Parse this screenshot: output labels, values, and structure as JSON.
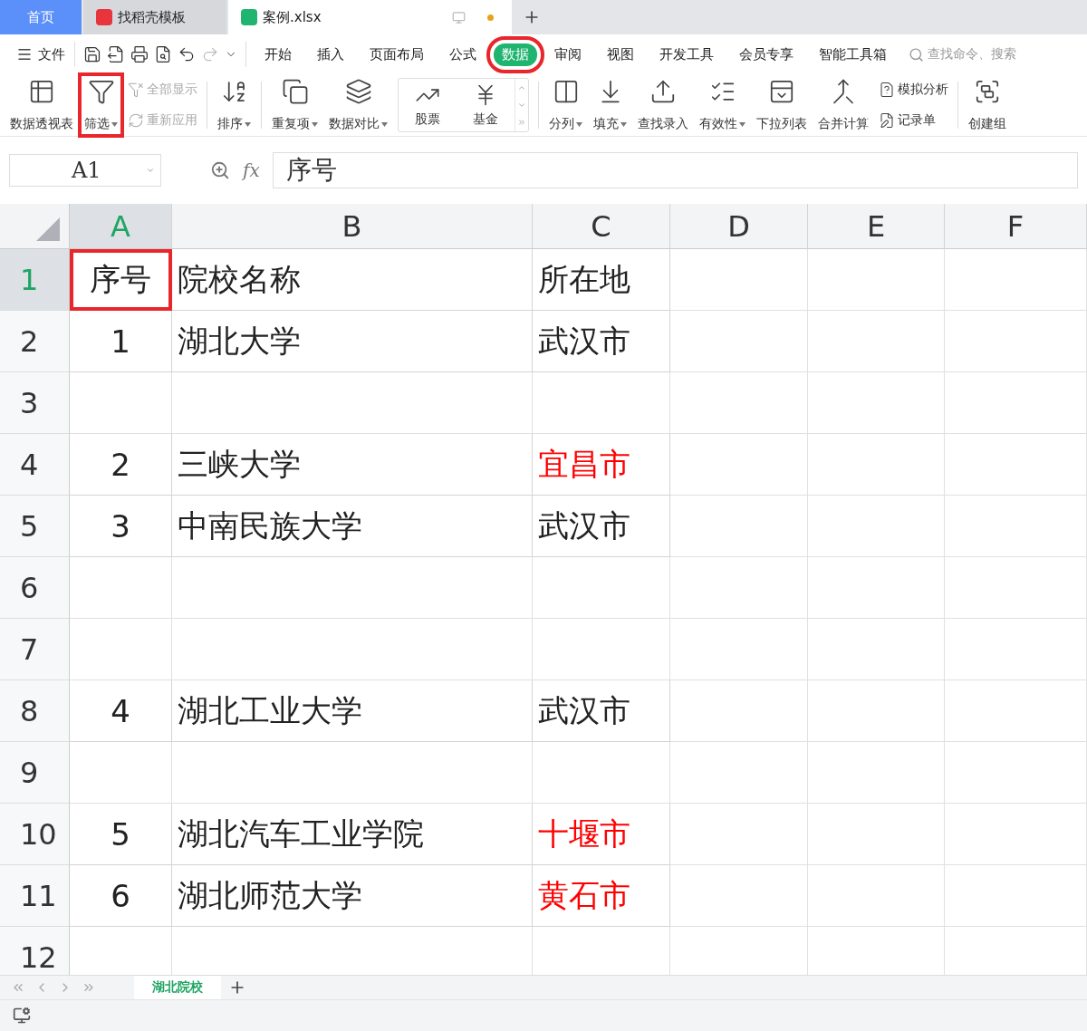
{
  "title_tabs": [
    {
      "label": "首页",
      "kind": "home",
      "selected": false
    },
    {
      "label": "找稻壳模板",
      "kind": "docer",
      "selected": false
    },
    {
      "label": "案例.xlsx",
      "kind": "sheet",
      "selected": true
    }
  ],
  "menu": {
    "file": "文件",
    "items": [
      {
        "label": "开始",
        "selected": false,
        "highlighted": false
      },
      {
        "label": "插入",
        "selected": false,
        "highlighted": false
      },
      {
        "label": "页面布局",
        "selected": false,
        "highlighted": false
      },
      {
        "label": "公式",
        "selected": false,
        "highlighted": false
      },
      {
        "label": "数据",
        "selected": true,
        "highlighted": true
      },
      {
        "label": "审阅",
        "selected": false,
        "highlighted": false
      },
      {
        "label": "视图",
        "selected": false,
        "highlighted": false
      },
      {
        "label": "开发工具",
        "selected": false,
        "highlighted": false
      },
      {
        "label": "会员专享",
        "selected": false,
        "highlighted": false
      },
      {
        "label": "智能工具箱",
        "selected": false,
        "highlighted": false
      }
    ],
    "search": {
      "placeholder": "查找命令、搜索"
    }
  },
  "ribbon": {
    "groups": [
      [
        {
          "kind": "large",
          "label": "数据透视表",
          "dropdown": false,
          "highlighted": false
        },
        {
          "kind": "large",
          "label": "筛选",
          "dropdown": true,
          "highlighted": true
        },
        {
          "kind": "stack",
          "items": [
            {
              "label": "全部显示",
              "disabled": true
            },
            {
              "label": "重新应用",
              "disabled": true
            }
          ]
        }
      ],
      [
        {
          "kind": "large",
          "label": "排序",
          "dropdown": true,
          "highlighted": false
        }
      ],
      [
        {
          "kind": "large",
          "label": "重复项",
          "dropdown": true,
          "highlighted": false
        },
        {
          "kind": "large",
          "label": "数据对比",
          "dropdown": true,
          "highlighted": false
        },
        {
          "kind": "gallery",
          "items": [
            {
              "label": "股票"
            },
            {
              "label": "基金"
            }
          ]
        }
      ],
      [
        {
          "kind": "large",
          "label": "分列",
          "dropdown": true,
          "highlighted": false
        },
        {
          "kind": "large",
          "label": "填充",
          "dropdown": true,
          "highlighted": false
        },
        {
          "kind": "large",
          "label": "查找录入",
          "dropdown": false,
          "highlighted": false
        },
        {
          "kind": "large",
          "label": "有效性",
          "dropdown": true,
          "highlighted": false
        },
        {
          "kind": "large",
          "label": "下拉列表",
          "dropdown": false,
          "highlighted": false
        },
        {
          "kind": "large",
          "label": "合并计算",
          "dropdown": false,
          "highlighted": false
        },
        {
          "kind": "stack",
          "items": [
            {
              "label": "模拟分析",
              "disabled": false
            },
            {
              "label": "记录单",
              "disabled": false
            }
          ]
        }
      ],
      [
        {
          "kind": "large",
          "label": "创建组",
          "dropdown": false,
          "highlighted": false
        }
      ]
    ]
  },
  "formula_bar": {
    "name_box": "A1",
    "fx": "fx",
    "value": "序号"
  },
  "columns": [
    {
      "label": "A",
      "selected": true
    },
    {
      "label": "B",
      "selected": false
    },
    {
      "label": "C",
      "selected": false
    },
    {
      "label": "D",
      "selected": false
    },
    {
      "label": "E",
      "selected": false
    },
    {
      "label": "F",
      "selected": false
    }
  ],
  "rows": [
    {
      "number": "1",
      "selected": true,
      "cells": [
        {
          "text": "序号",
          "highlighted": true
        },
        {
          "text": "院校名称"
        },
        {
          "text": "所在地"
        }
      ]
    },
    {
      "number": "2",
      "selected": false,
      "cells": [
        {
          "text": "1"
        },
        {
          "text": "湖北大学"
        },
        {
          "text": "武汉市"
        }
      ]
    },
    {
      "number": "3",
      "selected": false
    },
    {
      "number": "4",
      "selected": false,
      "cells": [
        {
          "text": "2"
        },
        {
          "text": "三峡大学"
        },
        {
          "text": "宜昌市",
          "color": "#ff0000"
        }
      ]
    },
    {
      "number": "5",
      "selected": false,
      "cells": [
        {
          "text": "3"
        },
        {
          "text": "中南民族大学"
        },
        {
          "text": "武汉市"
        }
      ]
    },
    {
      "number": "6",
      "selected": false
    },
    {
      "number": "7",
      "selected": false
    },
    {
      "number": "8",
      "selected": false,
      "cells": [
        {
          "text": "4"
        },
        {
          "text": "湖北工业大学"
        },
        {
          "text": "武汉市"
        }
      ]
    },
    {
      "number": "9",
      "selected": false
    },
    {
      "number": "10",
      "selected": false,
      "cells": [
        {
          "text": "5"
        },
        {
          "text": "湖北汽车工业学院"
        },
        {
          "text": "十堰市",
          "color": "#ff0000"
        }
      ]
    },
    {
      "number": "11",
      "selected": false,
      "cells": [
        {
          "text": "6"
        },
        {
          "text": "湖北师范大学"
        },
        {
          "text": "黄石市",
          "color": "#ff0000"
        }
      ]
    },
    {
      "number": "12",
      "selected": false
    }
  ],
  "sheet_tabs": [
    {
      "label": "湖北院校",
      "selected": true
    }
  ]
}
